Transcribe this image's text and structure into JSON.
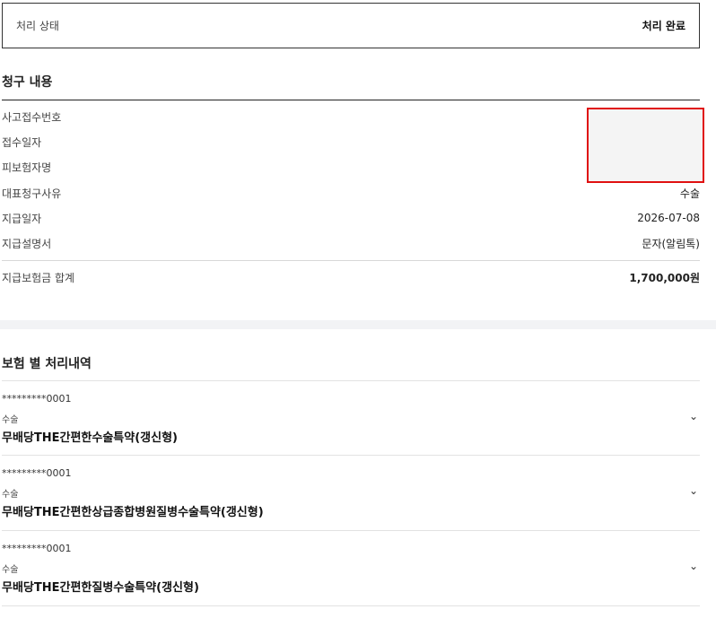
{
  "status": {
    "label": "처리 상태",
    "value": "처리 완료"
  },
  "claim": {
    "title": "청구 내용",
    "rows": [
      {
        "label": "사고접수번호",
        "value": ""
      },
      {
        "label": "접수일자",
        "value": ""
      },
      {
        "label": "피보험자명",
        "value": ""
      },
      {
        "label": "대표청구사유",
        "value": "수술"
      },
      {
        "label": "지급일자",
        "value": "2026-07-08"
      },
      {
        "label": "지급설명서",
        "value": "문자(알림톡)"
      }
    ],
    "total": {
      "label": "지급보험금 합계",
      "value": "1,700,000원"
    }
  },
  "insurance": {
    "title": "보험 별 처리내역",
    "items": [
      {
        "account": "*********0001",
        "type": "수술",
        "name": "무배당THE간편한수술특약(갱신형)"
      },
      {
        "account": "*********0001",
        "type": "수술",
        "name": "무배당THE간편한상급종합병원질병수술특약(갱신형)"
      },
      {
        "account": "*********0001",
        "type": "수술",
        "name": "무배당THE간편한질병수술특약(갱신형)"
      }
    ]
  },
  "icons": {
    "expand": "chevron-down-icon"
  },
  "colors": {
    "total_accent": "#1a2a8c",
    "highlight_box": "#e01010"
  }
}
